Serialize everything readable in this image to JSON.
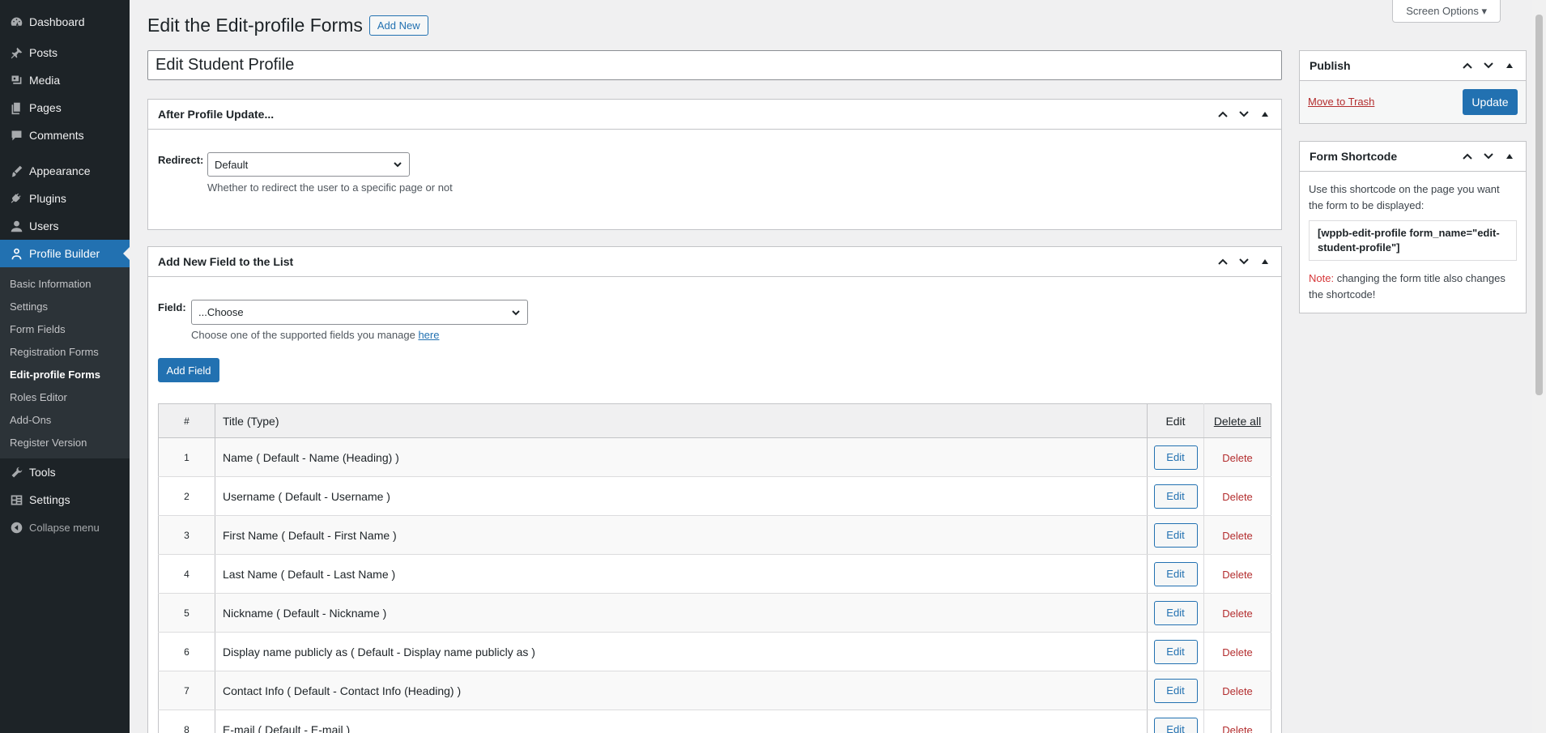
{
  "sidebar": {
    "items": [
      {
        "label": "Dashboard",
        "icon": "dashboard-icon"
      },
      {
        "label": "Posts",
        "icon": "pin-icon"
      },
      {
        "label": "Media",
        "icon": "media-icon"
      },
      {
        "label": "Pages",
        "icon": "pages-icon"
      },
      {
        "label": "Comments",
        "icon": "comments-icon"
      },
      {
        "label": "Appearance",
        "icon": "brush-icon"
      },
      {
        "label": "Plugins",
        "icon": "plug-icon"
      },
      {
        "label": "Users",
        "icon": "user-icon"
      },
      {
        "label": "Profile Builder",
        "icon": "profile-icon"
      },
      {
        "label": "Tools",
        "icon": "wrench-icon"
      },
      {
        "label": "Settings",
        "icon": "settings-icon"
      }
    ],
    "submenu": [
      "Basic Information",
      "Settings",
      "Form Fields",
      "Registration Forms",
      "Edit-profile Forms",
      "Roles Editor",
      "Add-Ons",
      "Register Version"
    ],
    "collapse_label": "Collapse menu"
  },
  "header": {
    "title": "Edit the Edit-profile Forms",
    "add_new": "Add New",
    "screen_options": "Screen Options ▾"
  },
  "form_title": "Edit Student Profile",
  "after_update": {
    "title": "After Profile Update...",
    "redirect_label": "Redirect:",
    "redirect_value": "Default",
    "redirect_desc": "Whether to redirect the user to a specific page or not"
  },
  "add_field": {
    "title": "Add New Field to the List",
    "field_label": "Field:",
    "field_value": "...Choose",
    "desc_prefix": "Choose one of the supported fields you manage",
    "desc_link": "here",
    "button": "Add Field"
  },
  "table": {
    "headers": {
      "num": "#",
      "title": "Title (Type)",
      "edit": "Edit",
      "delete_all": "Delete all"
    },
    "edit_label": "Edit",
    "delete_label": "Delete",
    "rows": [
      {
        "num": "1",
        "title": "Name ( Default - Name (Heading) )"
      },
      {
        "num": "2",
        "title": "Username ( Default - Username )"
      },
      {
        "num": "3",
        "title": "First Name ( Default - First Name )"
      },
      {
        "num": "4",
        "title": "Last Name ( Default - Last Name )"
      },
      {
        "num": "5",
        "title": "Nickname ( Default - Nickname )"
      },
      {
        "num": "6",
        "title": "Display name publicly as ( Default - Display name publicly as )"
      },
      {
        "num": "7",
        "title": "Contact Info ( Default - Contact Info (Heading) )"
      },
      {
        "num": "8",
        "title": "E-mail ( Default - E-mail )"
      }
    ]
  },
  "publish": {
    "title": "Publish",
    "trash": "Move to Trash",
    "update": "Update"
  },
  "shortcode": {
    "title": "Form Shortcode",
    "desc": "Use this shortcode on the page you want the form to be displayed:",
    "code_line1": "[wppb-edit-profile form_name=\"edit-",
    "code_line2": "student-profile\"]",
    "note_label": "Note:",
    "note_text": " changing the form title also changes the shortcode!"
  },
  "colors": {
    "accent": "#2271b1",
    "danger": "#b32d2e",
    "sidebar": "#1d2327"
  }
}
